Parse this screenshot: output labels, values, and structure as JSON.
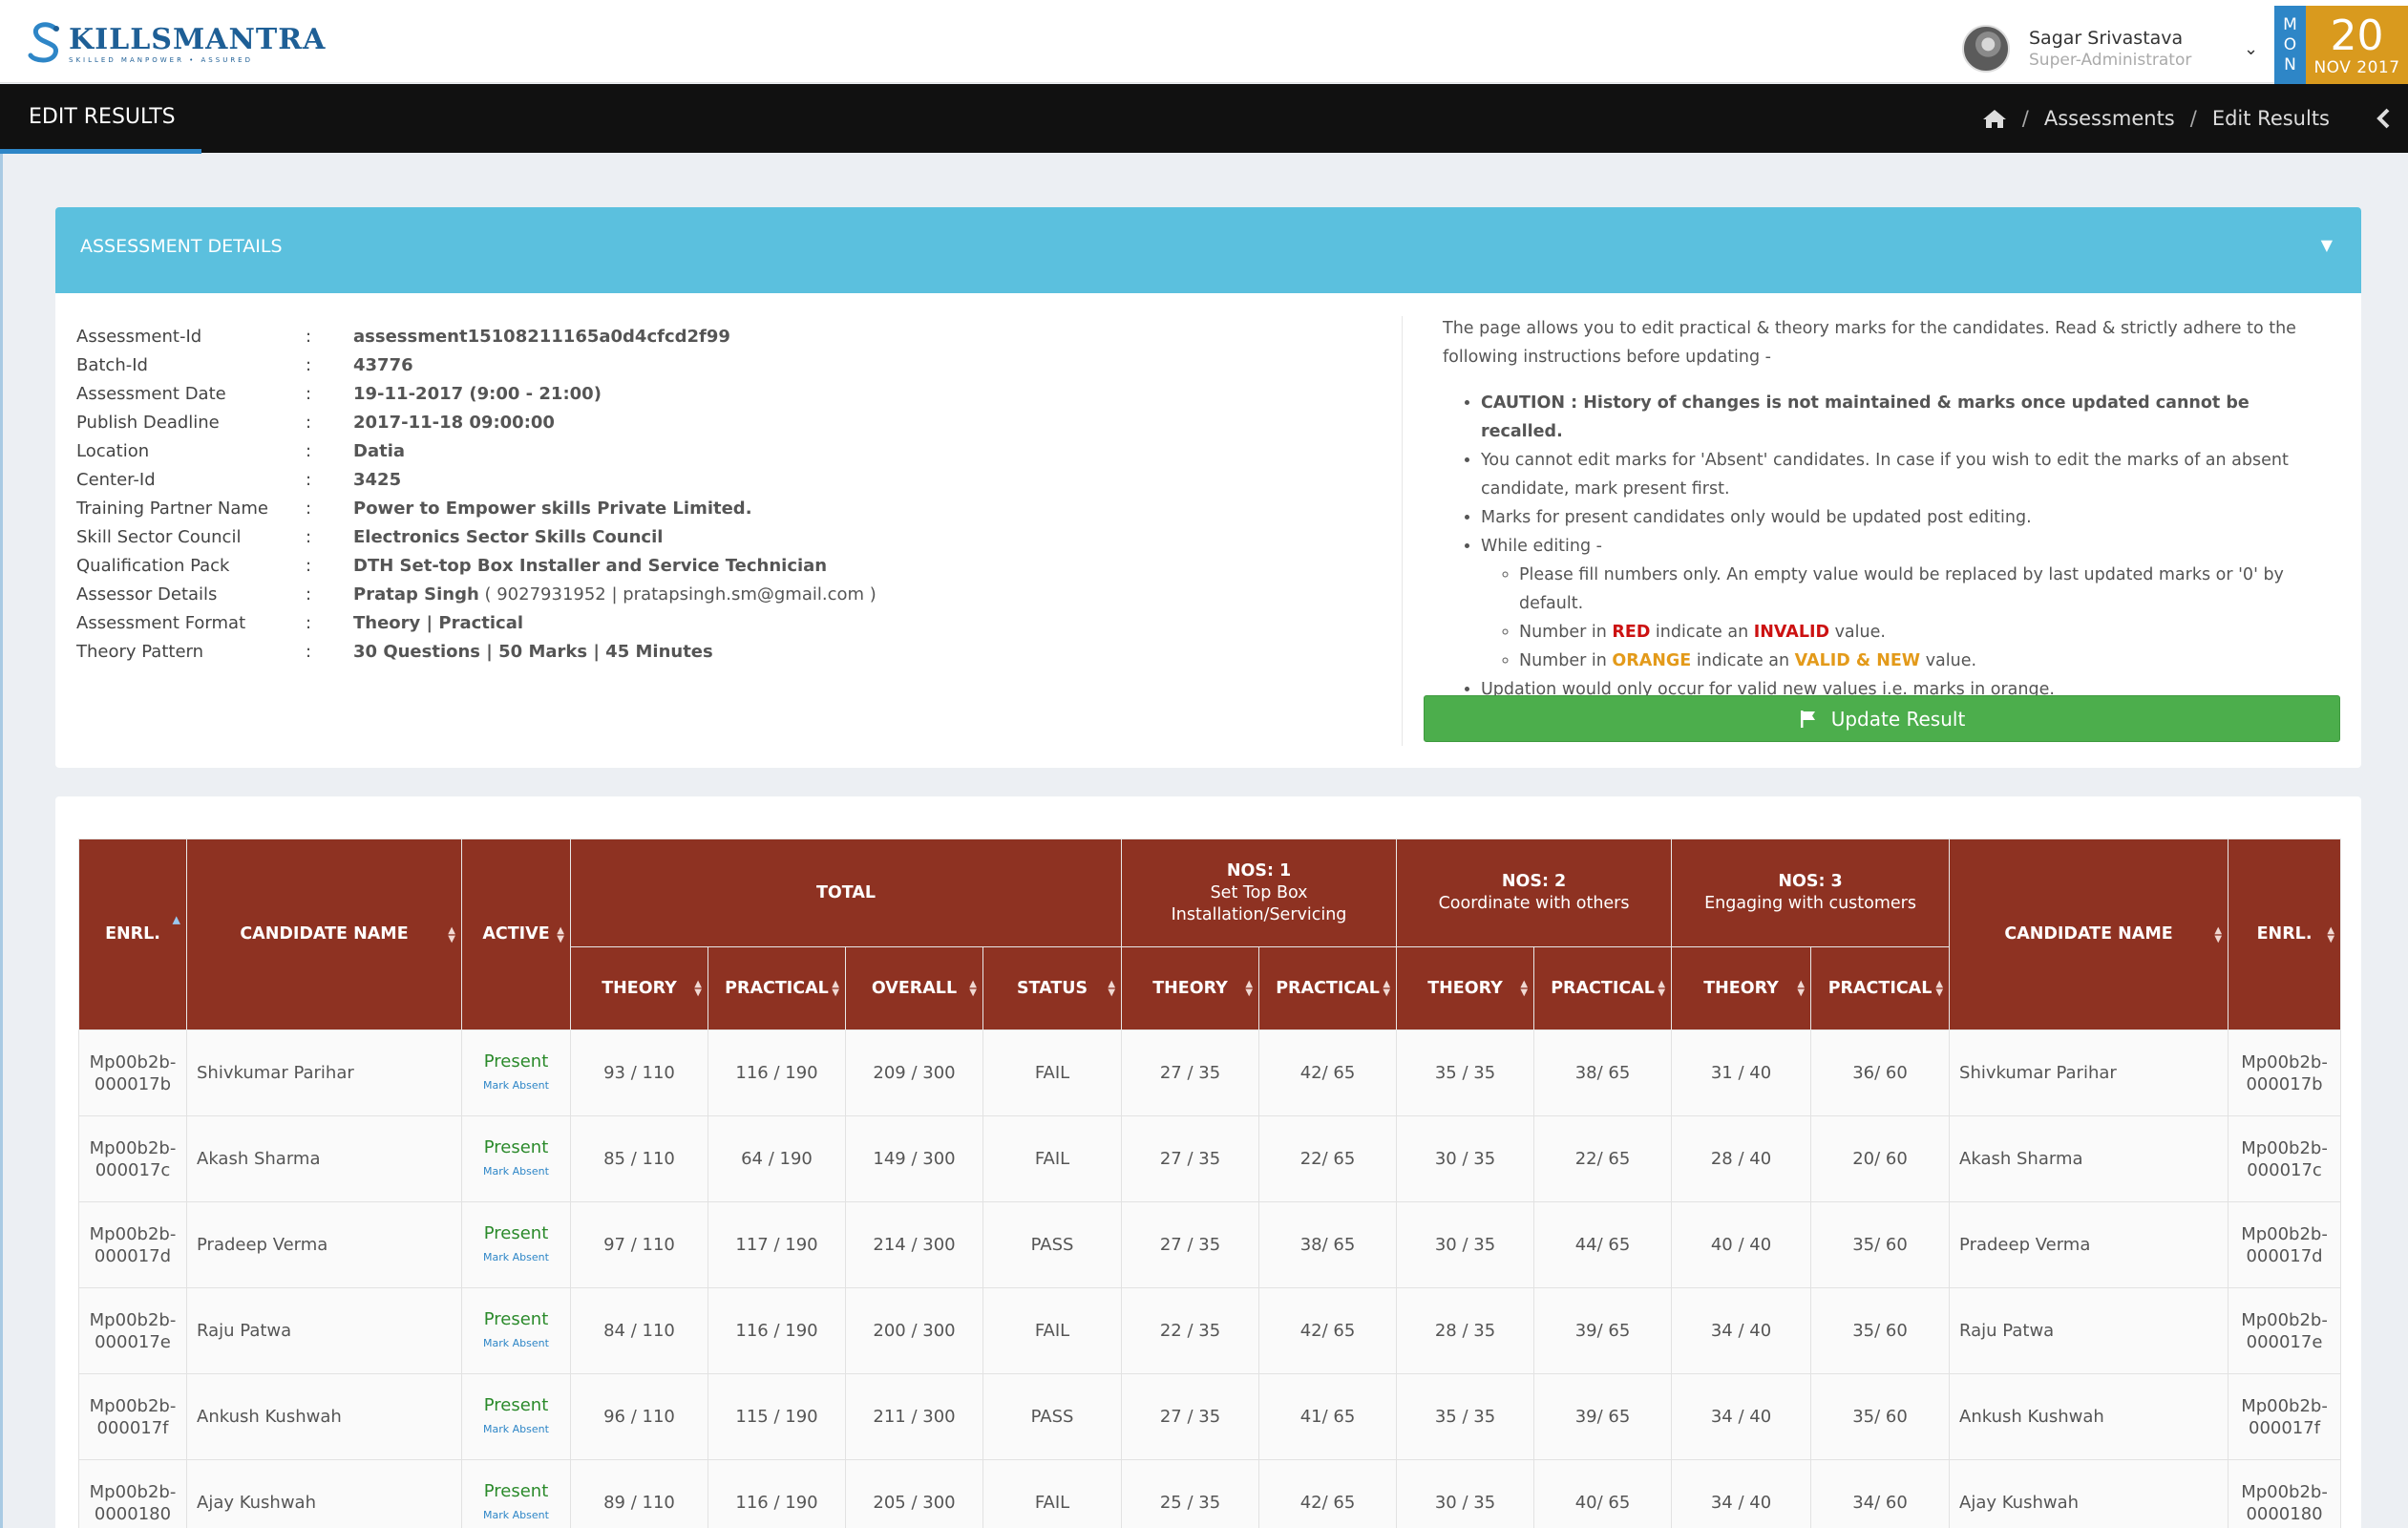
{
  "brand": {
    "name": "KILLSMANTRA",
    "tagline": "SKILLED MANPOWER • ASSURED"
  },
  "user": {
    "name": "Sagar Srivastava",
    "role": "Super-Administrator"
  },
  "date": {
    "weekday": [
      "M",
      "O",
      "N"
    ],
    "day": "20",
    "month_year": "NOV 2017"
  },
  "page": {
    "title": "EDIT RESULTS",
    "breadcrumb": [
      "Assessments",
      "Edit Results"
    ]
  },
  "panel": {
    "title": "ASSESSMENT DETAILS"
  },
  "details": [
    {
      "label": "Assessment-Id",
      "value": "assessment15108211165a0d4cfcd2f99"
    },
    {
      "label": "Batch-Id",
      "value": "43776"
    },
    {
      "label": "Assessment Date",
      "value": "19-11-2017 (9:00 - 21:00)"
    },
    {
      "label": "Publish Deadline",
      "value": "2017-11-18 09:00:00"
    },
    {
      "label": "Location",
      "value": "Datia"
    },
    {
      "label": "Center-Id",
      "value": "3425"
    },
    {
      "label": "Training Partner Name",
      "value": "Power to Empower skills Private Limited."
    },
    {
      "label": "Skill Sector Council",
      "value": "Electronics Sector Skills Council"
    },
    {
      "label": "Qualification Pack",
      "value": "DTH Set-top Box Installer and Service Technician"
    },
    {
      "label": "Assessor Details",
      "value": "Pratap Singh",
      "extra": " ( 9027931952 | pratapsingh.sm@gmail.com )"
    },
    {
      "label": "Assessment Format",
      "value": "Theory | Practical"
    },
    {
      "label": "Theory Pattern",
      "value": "30 Questions | 50 Marks | 45 Minutes"
    }
  ],
  "instructions": {
    "intro": "The page allows you to edit practical & theory marks for the candidates. Read & strictly adhere to the following instructions before updating -",
    "caution": "CAUTION : History of changes is not maintained & marks once updated cannot be recalled.",
    "absent": "You cannot edit marks for 'Absent' candidates. In case if you wish to edit the marks of an absent candidate, mark present first.",
    "present": "Marks for present candidates only would be updated post editing.",
    "while": "While editing -",
    "fill": "Please fill numbers only. An empty value would be replaced by last updated marks or '0' by default.",
    "red_pre": "Number in ",
    "red_word": "RED",
    "red_mid": " indicate an ",
    "red_word2": "INVALID",
    "red_post": " value.",
    "orange_pre": "Number in ",
    "orange_word": "ORANGE",
    "orange_mid": " indicate an ",
    "orange_word2": "VALID & NEW",
    "orange_post": " value.",
    "updation": "Updation would only occur for valid new values i.e. marks in orange."
  },
  "update_button": "Update Result",
  "table": {
    "headers": {
      "enrl": "ENRL.",
      "name": "CANDIDATE NAME",
      "active": "ACTIVE",
      "total": "TOTAL",
      "theory": "THEORY",
      "practical": "PRACTICAL",
      "overall": "OVERALL",
      "status": "STATUS",
      "nos1": "NOS: 1",
      "nos1_sub": "Set Top Box Installation/Servicing",
      "nos2": "NOS: 2",
      "nos2_sub": "Coordinate with others",
      "nos3": "NOS: 3",
      "nos3_sub": "Engaging with customers"
    },
    "present_label": "Present",
    "mark_absent_label": "Mark Absent",
    "rows": [
      {
        "enrl": [
          "Mp00b2b-",
          "000017b"
        ],
        "name": "Shivkumar Parihar",
        "theory": "93 / 110",
        "practical": "116 / 190",
        "overall": "209 / 300",
        "status": "FAIL",
        "n1t": "27 / 35",
        "n1p": "42/ 65",
        "n2t": "35 / 35",
        "n2p": "38/ 65",
        "n3t": "31 / 40",
        "n3p": "36/ 60"
      },
      {
        "enrl": [
          "Mp00b2b-",
          "000017c"
        ],
        "name": "Akash Sharma",
        "theory": "85 / 110",
        "practical": "64 / 190",
        "overall": "149 / 300",
        "status": "FAIL",
        "n1t": "27 / 35",
        "n1p": "22/ 65",
        "n2t": "30 / 35",
        "n2p": "22/ 65",
        "n3t": "28 / 40",
        "n3p": "20/ 60"
      },
      {
        "enrl": [
          "Mp00b2b-",
          "000017d"
        ],
        "name": "Pradeep Verma",
        "theory": "97 / 110",
        "practical": "117 / 190",
        "overall": "214 / 300",
        "status": "PASS",
        "n1t": "27 / 35",
        "n1p": "38/ 65",
        "n2t": "30 / 35",
        "n2p": "44/ 65",
        "n3t": "40 / 40",
        "n3p": "35/ 60"
      },
      {
        "enrl": [
          "Mp00b2b-",
          "000017e"
        ],
        "name": "Raju Patwa",
        "theory": "84 / 110",
        "practical": "116 / 190",
        "overall": "200 / 300",
        "status": "FAIL",
        "n1t": "22 / 35",
        "n1p": "42/ 65",
        "n2t": "28 / 35",
        "n2p": "39/ 65",
        "n3t": "34 / 40",
        "n3p": "35/ 60"
      },
      {
        "enrl": [
          "Mp00b2b-",
          "000017f"
        ],
        "name": "Ankush Kushwah",
        "theory": "96 / 110",
        "practical": "115 / 190",
        "overall": "211 / 300",
        "status": "PASS",
        "n1t": "27 / 35",
        "n1p": "41/ 65",
        "n2t": "35 / 35",
        "n2p": "39/ 65",
        "n3t": "34 / 40",
        "n3p": "35/ 60"
      },
      {
        "enrl": [
          "Mp00b2b-",
          "0000180"
        ],
        "name": "Ajay Kushwah",
        "theory": "89 / 110",
        "practical": "116 / 190",
        "overall": "205 / 300",
        "status": "FAIL",
        "n1t": "25 / 35",
        "n1p": "42/ 65",
        "n2t": "30 / 35",
        "n2p": "40/ 65",
        "n3t": "34 / 40",
        "n3p": "34/ 60"
      }
    ]
  },
  "colors": {
    "accent": "#2e86c7",
    "header_bg": "#8e3222",
    "panel_head": "#5bc0de",
    "fail": "#cc1111",
    "pass": "#2b8a2b",
    "date_bg": "#d99a1e",
    "button": "#4cae4c"
  },
  "icons": [
    "home-icon",
    "chevron-left-icon",
    "chevron-down-icon",
    "flag-icon",
    "sort-icon",
    "avatar"
  ]
}
